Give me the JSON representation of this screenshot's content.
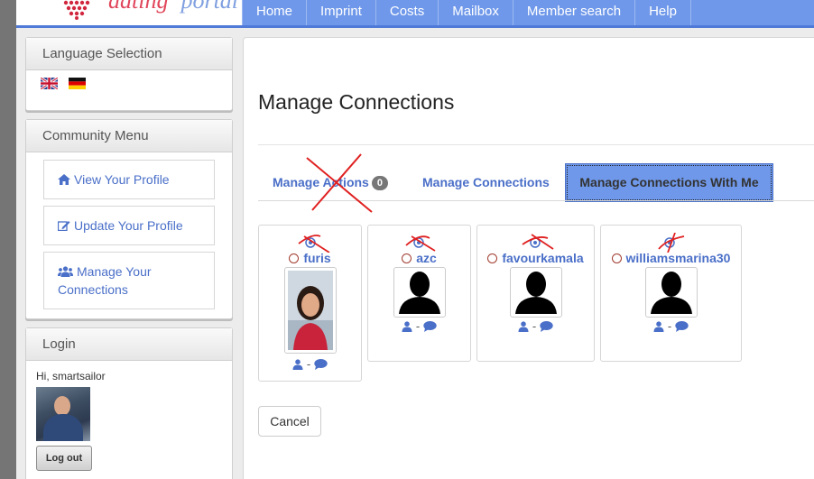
{
  "logo": {
    "word1": "dating",
    "word2": "portal"
  },
  "nav": {
    "items": [
      "Home",
      "Imprint",
      "Costs",
      "Mailbox",
      "Member search",
      "Help"
    ]
  },
  "language_panel": {
    "title": "Language Selection",
    "flags": [
      "uk-flag-icon",
      "germany-flag-icon"
    ]
  },
  "community_panel": {
    "title": "Community Menu",
    "items": [
      {
        "label": "View Your Profile",
        "icon": "home-icon"
      },
      {
        "label": "Update Your Profile",
        "icon": "edit-icon"
      },
      {
        "label": "Manage Your Connections",
        "icon": "users-icon"
      }
    ]
  },
  "login_panel": {
    "title": "Login",
    "greeting": "Hi, smartsailor",
    "logout_label": "Log out"
  },
  "main": {
    "title": "Manage Connections",
    "tabs": [
      {
        "label": "Manage Actions",
        "badge": "0"
      },
      {
        "label": "Manage Connections"
      },
      {
        "label": "Manage Connections With Me",
        "active": true
      }
    ],
    "connections": [
      {
        "name": "furis",
        "has_photo": true
      },
      {
        "name": "azc",
        "has_photo": false
      },
      {
        "name": "favourkamala",
        "has_photo": false
      },
      {
        "name": "williamsmarina30",
        "has_photo": false
      }
    ],
    "action_separator": "-",
    "cancel_label": "Cancel"
  },
  "colors": {
    "nav": "#6f98ea",
    "link": "#4a6fc8",
    "annotation": "#e02020",
    "radio": "#a13b2e"
  }
}
